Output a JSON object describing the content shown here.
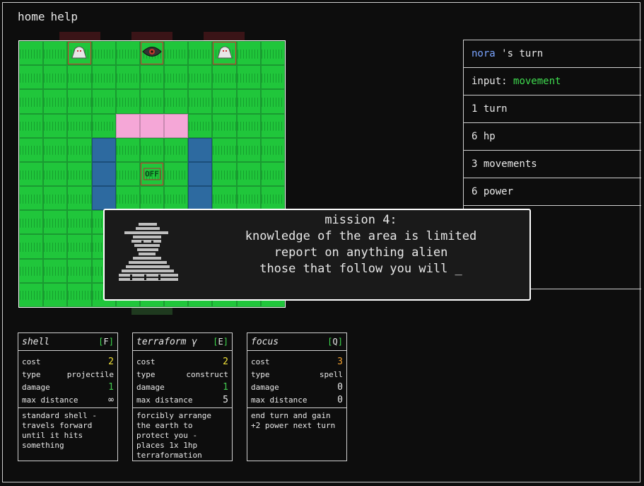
{
  "nav": {
    "home": "home",
    "help": "help"
  },
  "board": {
    "size": 11,
    "pink_cells": [
      [
        3,
        4
      ],
      [
        3,
        5
      ],
      [
        3,
        6
      ]
    ],
    "water_cells": [
      [
        4,
        3
      ],
      [
        5,
        3
      ],
      [
        6,
        3
      ],
      [
        4,
        7
      ],
      [
        5,
        7
      ],
      [
        6,
        7
      ]
    ],
    "off_cell": [
      5,
      5
    ],
    "off_label": "OFF",
    "ghosts": [
      [
        0,
        2
      ],
      [
        0,
        8
      ]
    ],
    "eye": [
      0,
      5
    ]
  },
  "side": {
    "player": "nora",
    "turn_suffix": "'s turn",
    "input_label": "input:",
    "input_value": "movement",
    "turn": "1 turn",
    "hp": "6 hp",
    "movements": "3 movements",
    "power": "6 power"
  },
  "dialog": {
    "line1": "mission 4:",
    "line2": "knowledge of the area is limited",
    "line3": "report on anything alien",
    "line4": "those that follow you will _"
  },
  "cards": [
    {
      "name": "shell",
      "key": "F",
      "cost": "2",
      "cost_color": "yellow",
      "type": "projectile",
      "damage": "1",
      "damage_color": "green",
      "max_distance": "∞",
      "desc": "standard shell -\ntravels forward\nuntil it hits\nsomething"
    },
    {
      "name": "terraform γ",
      "key": "E",
      "cost": "2",
      "cost_color": "yellow",
      "type": "construct",
      "damage": "1",
      "damage_color": "green",
      "max_distance": "5",
      "desc": "forcibly arrange\nthe earth to\nprotect you -\nplaces 1x 1hp\nterraformation"
    },
    {
      "name": "focus",
      "key": "Q",
      "cost": "3",
      "cost_color": "orange",
      "type": "spell",
      "damage": "0",
      "damage_color": "white",
      "max_distance": "0",
      "desc": "end turn and gain\n+2 power next turn"
    }
  ],
  "labels": {
    "cost": "cost",
    "type": "type",
    "damage": "damage",
    "max_distance": "max distance"
  }
}
